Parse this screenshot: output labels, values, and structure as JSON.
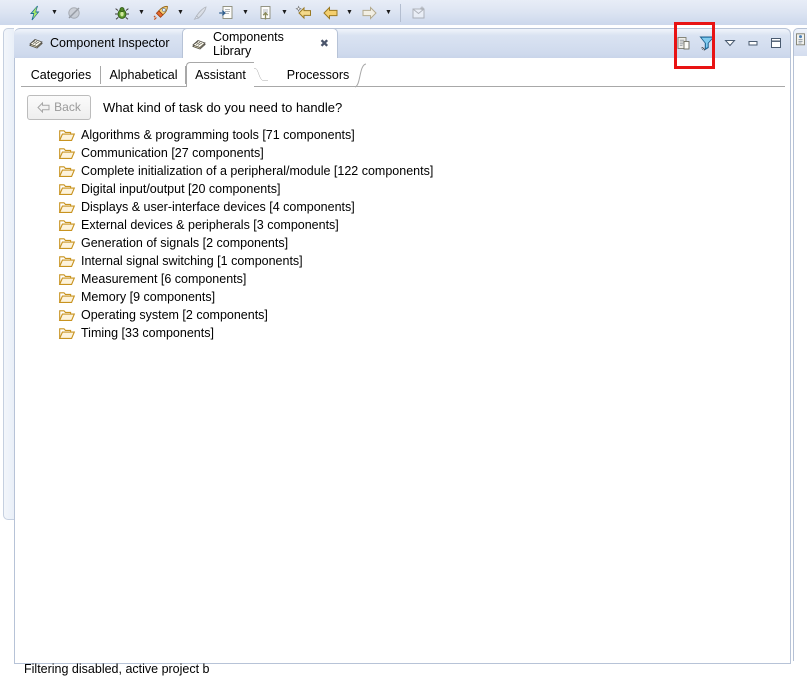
{
  "toolbar": {
    "items": [
      {
        "name": "run-icon",
        "label": "Run",
        "has_dropdown": true,
        "enabled": true
      },
      {
        "name": "disabled-globe-icon",
        "label": "Disabled Tool",
        "has_dropdown": false,
        "enabled": false
      },
      {
        "name": "debug-bug-icon",
        "label": "Debug",
        "has_dropdown": true,
        "enabled": true
      },
      {
        "name": "build-rocket-icon",
        "label": "Build",
        "has_dropdown": true,
        "enabled": true
      },
      {
        "name": "pen-icon",
        "label": "Edit",
        "has_dropdown": false,
        "enabled": false
      },
      {
        "name": "import-document-icon",
        "label": "Import",
        "has_dropdown": true,
        "enabled": true
      },
      {
        "name": "export-document-icon",
        "label": "Export",
        "has_dropdown": true,
        "enabled": true
      },
      {
        "name": "back-star-arrow-icon",
        "label": "Back To",
        "has_dropdown": false,
        "enabled": true
      },
      {
        "name": "back-arrow-icon",
        "label": "Back",
        "has_dropdown": true,
        "enabled": true
      },
      {
        "name": "forward-arrow-icon",
        "label": "Forward",
        "has_dropdown": true,
        "enabled": false
      },
      {
        "name": "new-window-icon",
        "label": "New Window",
        "has_dropdown": false,
        "enabled": false
      }
    ]
  },
  "view_tabs": [
    {
      "label": "Component Inspector",
      "icon": "components-icon",
      "selected": false,
      "closable": false
    },
    {
      "label": "Components Library",
      "icon": "components-icon",
      "selected": true,
      "closable": true,
      "close_glyph": "✖"
    }
  ],
  "view_toolbar": {
    "buttons": [
      {
        "name": "copy-document-icon",
        "tooltip": "Copy"
      },
      {
        "name": "filter-funnel-icon",
        "tooltip": "Filter",
        "highlighted": true
      },
      {
        "name": "view-menu-chevron-icon",
        "tooltip": "View Menu"
      },
      {
        "name": "minimize-icon",
        "tooltip": "Minimize"
      },
      {
        "name": "maximize-icon",
        "tooltip": "Maximize"
      }
    ],
    "highlight_color": "#e81313"
  },
  "inner_tabs": [
    {
      "label": "Categories",
      "selected": false
    },
    {
      "label": "Alphabetical",
      "selected": false
    },
    {
      "label": "Assistant",
      "selected": true
    },
    {
      "label": "Processors",
      "selected": false
    }
  ],
  "assistant": {
    "back_label": "Back",
    "back_enabled": false,
    "back_icon": "left-arrow-icon",
    "question": "What kind of task do you need to handle?"
  },
  "categories": [
    {
      "icon": "folder-icon",
      "label": "Algorithms & programming tools [71 components]"
    },
    {
      "icon": "folder-icon",
      "label": "Communication [27 components]"
    },
    {
      "icon": "folder-icon",
      "label": "Complete initialization of a peripheral/module [122 components]"
    },
    {
      "icon": "folder-icon",
      "label": "Digital input/output [20 components]"
    },
    {
      "icon": "folder-icon",
      "label": "Displays & user-interface devices [4 components]"
    },
    {
      "icon": "folder-icon",
      "label": "External devices & peripherals [3 components]"
    },
    {
      "icon": "folder-icon",
      "label": "Generation of signals [2 components]"
    },
    {
      "icon": "folder-icon",
      "label": "Internal signal switching [1 components]"
    },
    {
      "icon": "folder-icon",
      "label": "Measurement [6 components]"
    },
    {
      "icon": "folder-icon",
      "label": "Memory [9 components]"
    },
    {
      "icon": "folder-icon",
      "label": "Operating system [2 components]"
    },
    {
      "icon": "folder-icon",
      "label": "Timing [33 components]"
    }
  ],
  "status_bar": {
    "text": "Filtering disabled, active project b"
  },
  "right_stack": {
    "icon": "properties-icon"
  }
}
